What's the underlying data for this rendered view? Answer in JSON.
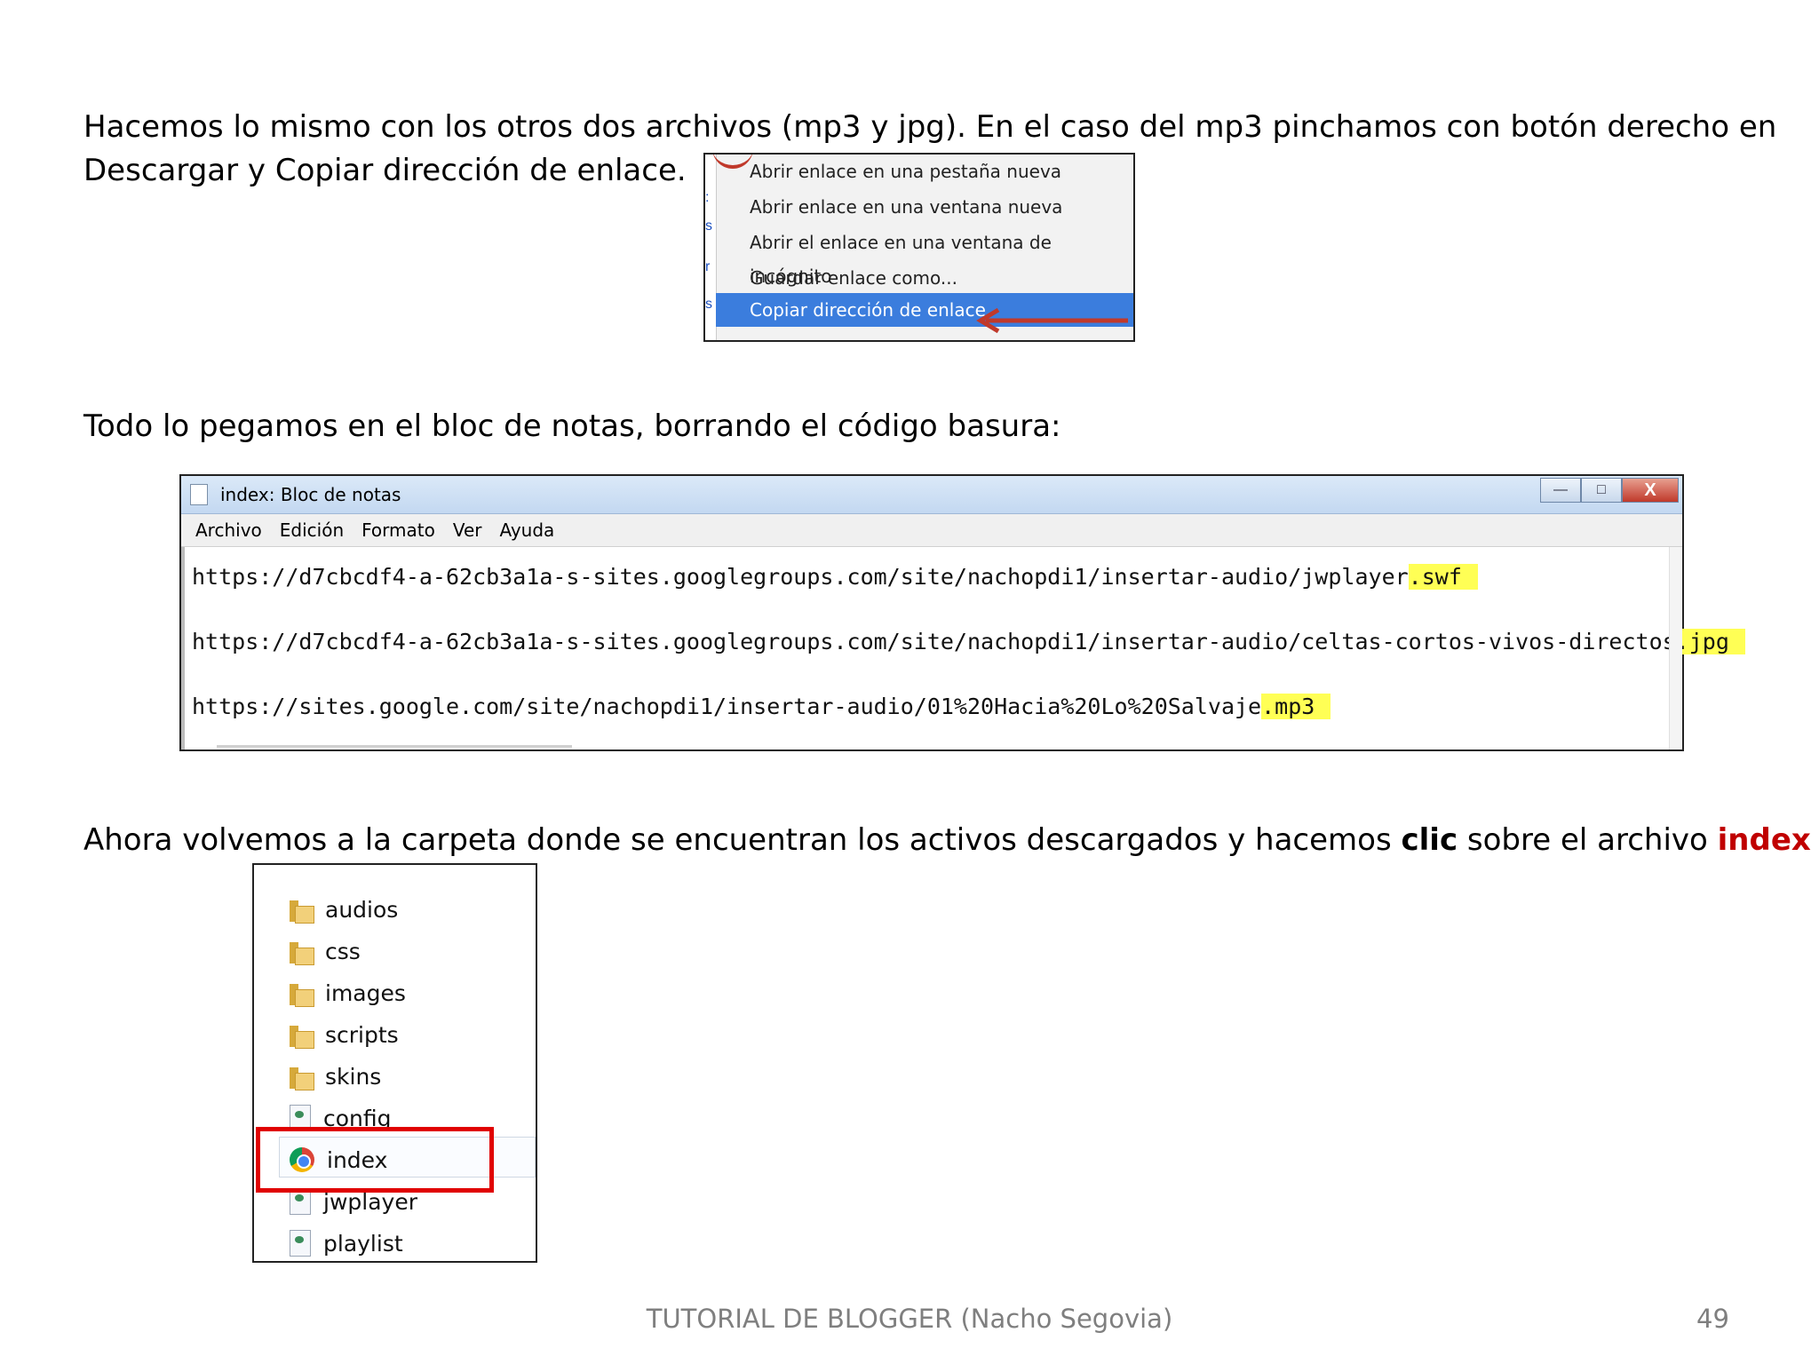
{
  "intro": {
    "line1": "Hacemos lo mismo con los otros dos archivos (mp3 y jpg). En el caso del mp3 pinchamos con botón derecho en",
    "line2": "Descargar y Copiar dirección de enlace."
  },
  "context_menu": {
    "items": [
      "Abrir enlace en una pestaña nueva",
      "Abrir enlace en una ventana nueva",
      "Abrir el enlace en una ventana de incógnito",
      "Guardar enlace como...",
      "Copiar dirección de enlace"
    ],
    "selected_index": 4,
    "selection_color": "#3b7ddd",
    "arrow_color": "#c0392b"
  },
  "paste_instruction": "Todo lo pegamos en el bloc de notas, borrando el código basura:",
  "notepad": {
    "title": "index: Bloc de notas",
    "menu": [
      "Archivo",
      "Edición",
      "Formato",
      "Ver",
      "Ayuda"
    ],
    "lines": [
      {
        "prefix": "https://d7cbcdf4-a-62cb3a1a-s-sites.googlegroups.com/site/nachopdi1/insertar-audio/jwplayer",
        "ext": ".swf"
      },
      {
        "prefix": "https://d7cbcdf4-a-62cb3a1a-s-sites.googlegroups.com/site/nachopdi1/insertar-audio/celtas-cortos-vivos-directos",
        "ext": ".jpg"
      },
      {
        "prefix": "https://sites.google.com/site/nachopdi1/insertar-audio/01%20Hacia%20Lo%20Salvaje",
        "ext": ".mp3"
      }
    ],
    "highlight_color": "#ffff55",
    "close_glyph": "X"
  },
  "folder_instruction": {
    "before": "Ahora volvemos a la carpeta donde se encuentran los activos descargados y hacemos ",
    "bold": "clic",
    "middle": " sobre el archivo ",
    "red_bold": "index",
    "red_color": "#c00000"
  },
  "explorer": {
    "items": [
      {
        "name": "audios",
        "icon": "folder-icon"
      },
      {
        "name": "css",
        "icon": "folder-icon"
      },
      {
        "name": "images",
        "icon": "folder-icon"
      },
      {
        "name": "scripts",
        "icon": "folder-icon"
      },
      {
        "name": "skins",
        "icon": "folder-icon"
      },
      {
        "name": "config",
        "icon": "file-icon"
      },
      {
        "name": "index",
        "icon": "chrome-icon"
      },
      {
        "name": "jwplayer",
        "icon": "file-icon"
      },
      {
        "name": "playlist",
        "icon": "file-icon"
      }
    ],
    "selected": "index",
    "selection_color": "#e00000"
  },
  "footer": {
    "text": "TUTORIAL DE BLOGGER (Nacho Segovia)",
    "page": "49"
  }
}
